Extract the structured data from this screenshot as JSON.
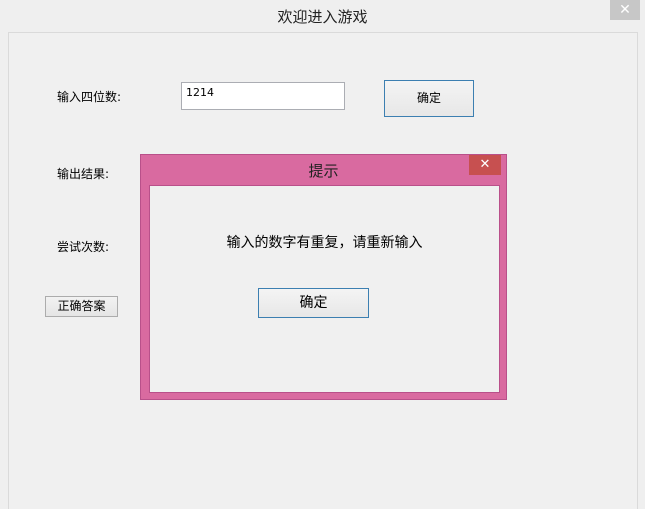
{
  "window": {
    "title": "欢迎进入游戏",
    "close_glyph": "✕"
  },
  "form": {
    "input_label": "输入四位数:",
    "input_value": "1214",
    "confirm_button": "确定",
    "output_label": "输出结果:",
    "attempts_label": "尝试次数:",
    "answer_button": "正确答案"
  },
  "dialog": {
    "title": "提示",
    "close_glyph": "✕",
    "message": "输入的数字有重复，请重新输入",
    "ok_button": "确定",
    "frame_color": "#d96aa0",
    "close_color": "#c75050"
  }
}
